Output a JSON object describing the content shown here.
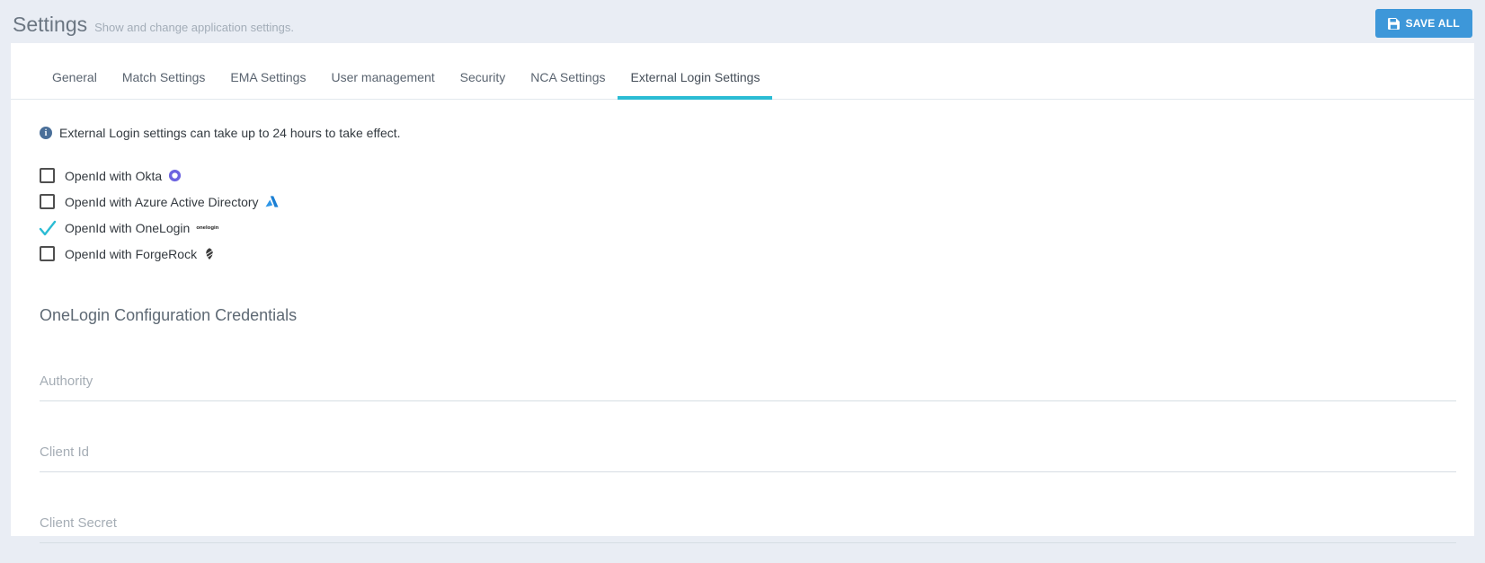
{
  "header": {
    "title": "Settings",
    "subtitle": "Show and change application settings.",
    "save_button": {
      "label": "SAVE ALL",
      "icon": "save-floppy-icon",
      "color": "#3d97d9"
    }
  },
  "tabs": [
    {
      "label": "General",
      "active": false
    },
    {
      "label": "Match Settings",
      "active": false
    },
    {
      "label": "EMA Settings",
      "active": false
    },
    {
      "label": "User management",
      "active": false
    },
    {
      "label": "Security",
      "active": false
    },
    {
      "label": "NCA Settings",
      "active": false
    },
    {
      "label": "External Login Settings",
      "active": true
    }
  ],
  "notice": {
    "icon": "info-icon",
    "text": "External Login settings can take up to 24 hours to take effect."
  },
  "providers": [
    {
      "label": "OpenId with Okta",
      "checked": false,
      "icon": "okta-logo"
    },
    {
      "label": "OpenId with Azure Active Directory",
      "checked": false,
      "icon": "azure-logo"
    },
    {
      "label": "OpenId with OneLogin",
      "checked": true,
      "icon": "onelogin-logo",
      "logo_text": "onelogin"
    },
    {
      "label": "OpenId with ForgeRock",
      "checked": false,
      "icon": "forgerock-logo"
    }
  ],
  "section": {
    "title": "OneLogin Configuration Credentials"
  },
  "fields": [
    {
      "placeholder": "Authority",
      "value": ""
    },
    {
      "placeholder": "Client Id",
      "value": ""
    },
    {
      "placeholder": "Client Secret",
      "value": ""
    }
  ],
  "colors": {
    "background": "#e9edf4",
    "card": "#ffffff",
    "accent_teal": "#2bbcd4",
    "button_blue": "#3d97d9",
    "info_blue": "#4a6f99",
    "okta_purple": "#6c63e0",
    "azure_blue": "#1b7fd4"
  }
}
